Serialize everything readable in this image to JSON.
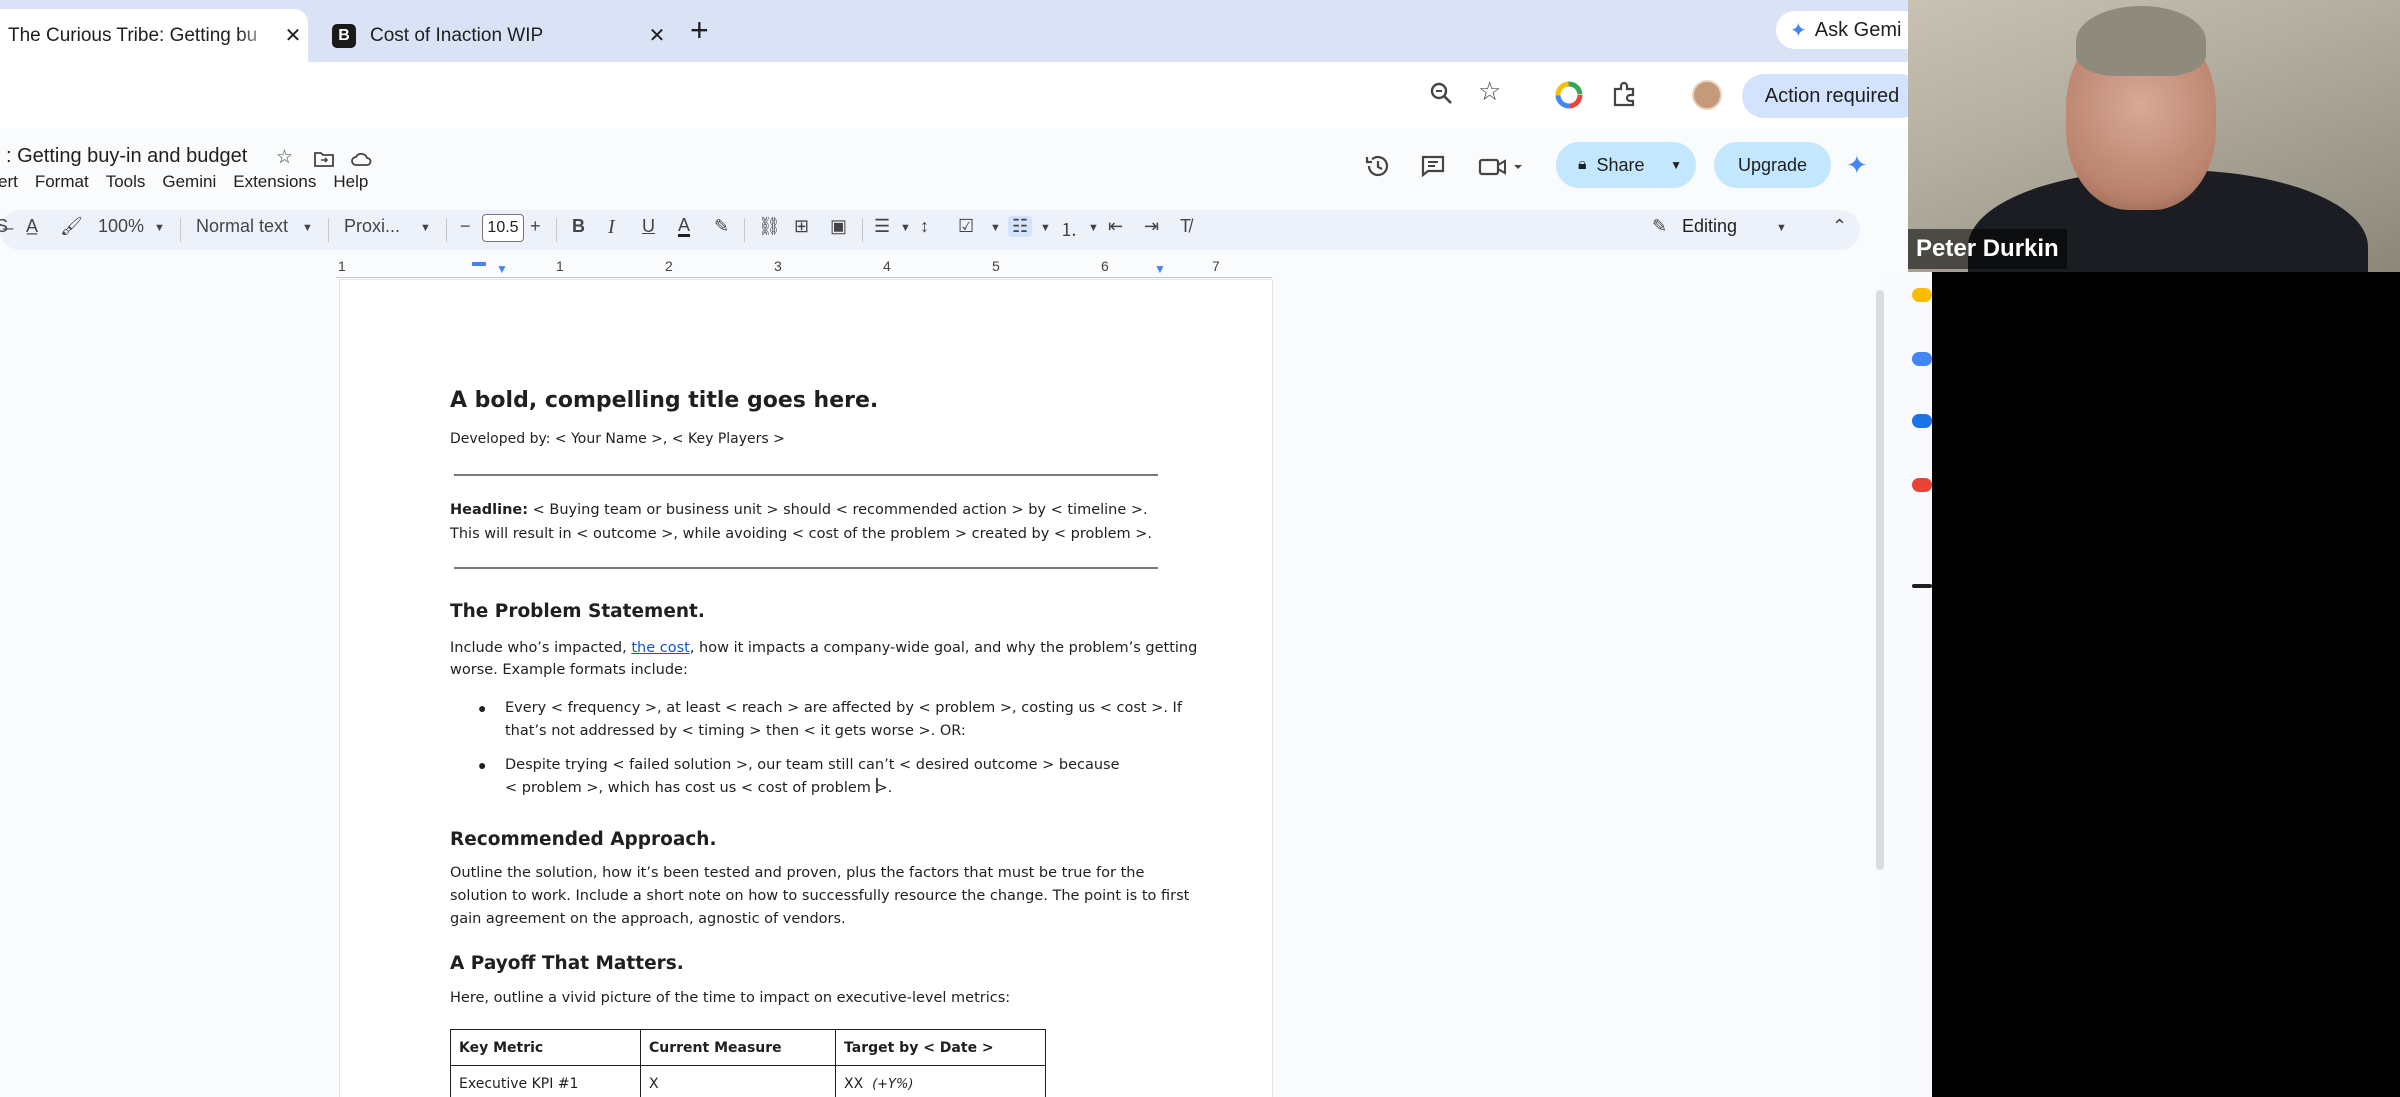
{
  "browser": {
    "tabs": [
      {
        "title": "The Curious Tribe: Getting bu",
        "active": true
      },
      {
        "title": "Cost of Inaction WIP",
        "favicon": "B",
        "active": false
      }
    ],
    "new_tab": "+",
    "ask_gemini": "Ask Gemi",
    "action_required": "Action required"
  },
  "docs": {
    "title": ": Getting buy-in and budget",
    "menu": [
      "ert",
      "Format",
      "Tools",
      "Gemini",
      "Extensions",
      "Help"
    ],
    "share": "Share",
    "upgrade": "Upgrade",
    "toolbar": {
      "zoom": "100%",
      "style": "Normal text",
      "font": "Proxi...",
      "font_size": "10.5",
      "mode": "Editing"
    },
    "ruler": [
      "1",
      "1",
      "2",
      "3",
      "4",
      "5",
      "6",
      "7"
    ]
  },
  "document": {
    "title": "A bold, compelling title goes here.",
    "developed_by": "Developed by: < Your Name >, < Key Players >",
    "headline_label": "Headline:",
    "headline_line1": " < Buying team or business unit > should < recommended action > by < timeline >.",
    "headline_line2": "This will result in < outcome >, while avoiding < cost of the problem > created by < problem >.",
    "problem_heading": "The Problem Statement.",
    "problem_pre": "Include who’s impacted, ",
    "problem_link": "the cost",
    "problem_post": ", how it impacts a company-wide goal, and why the problem’s getting",
    "problem_line2": "worse. Example formats include:",
    "bullet1_line1": "Every < frequency >,  at least < reach > are affected by < problem >, costing us < cost >.  If",
    "bullet1_line2": "that’s not addressed by < timing > then < it gets worse >. OR:",
    "bullet2_line1": "Despite trying < failed solution >, our team still can’t < desired outcome > because",
    "bullet2_line2": "< problem >, which has cost us < cost of problem >.",
    "approach_heading": "Recommended Approach.",
    "approach_line1": "Outline the solution, how it’s been tested and proven, plus the factors that must be true for the",
    "approach_line2": "solution to work. Include a short note on how to successfully resource the change. The point is to first",
    "approach_line3": "gain agreement on the approach, agnostic of vendors.",
    "payoff_heading": "A Payoff That Matters.",
    "payoff_line": "Here, outline a vivid picture of the time to impact on executive-level metrics:",
    "table": {
      "headers": [
        "Key Metric",
        "Current Measure",
        "Target by < Date >"
      ],
      "row1": [
        "Executive KPI #1",
        "X",
        "XX",
        "(+Y%)"
      ]
    }
  },
  "video": {
    "participant": "Peter Durkin"
  }
}
